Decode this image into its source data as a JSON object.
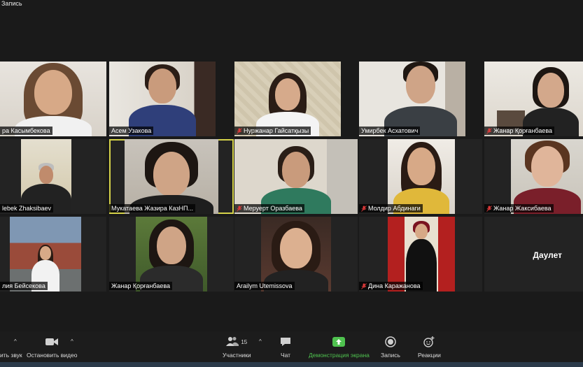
{
  "recording_label": "Запись",
  "participants": [
    {
      "name": "ра Касымбекова",
      "muted": false
    },
    {
      "name": "Асем Узакова",
      "muted": false
    },
    {
      "name": "Нуржанар Гайсатқызы",
      "muted": true
    },
    {
      "name": "Умирбек Асхатович",
      "muted": false
    },
    {
      "name": "Жанар Қорғанбаева",
      "muted": true
    },
    {
      "name": "lebek Zhaksibaev",
      "muted": false
    },
    {
      "name": "Мукатаева Жазира КазНП...",
      "muted": false,
      "active_speaker": true
    },
    {
      "name": "Меруерт Оразбаева",
      "muted": true
    },
    {
      "name": "Молдир Абдинаги",
      "muted": true
    },
    {
      "name": "Жанар Жаксибаева",
      "muted": true
    },
    {
      "name": "лия Бейсекова",
      "muted": false
    },
    {
      "name": "Жанар Қорғанбаева",
      "muted": false
    },
    {
      "name": "Arailym Utemissova",
      "muted": false
    },
    {
      "name": "Дина Каражанова",
      "muted": true
    },
    {
      "name": "Даулет",
      "muted": false,
      "no_video": true
    }
  ],
  "toolbar": {
    "audio_label": "ить звук",
    "video_label": "Остановить видео",
    "participants_label": "Участники",
    "participants_count": "15",
    "chat_label": "Чат",
    "share_label": "Демонстрация экрана",
    "record_label": "Запись",
    "reactions_label": "Реакции"
  },
  "colors": {
    "background": "#1a1a1a",
    "active_speaker_border": "#d6d34a",
    "share_green": "#4fc24f",
    "muted_red": "#e03a3a"
  }
}
